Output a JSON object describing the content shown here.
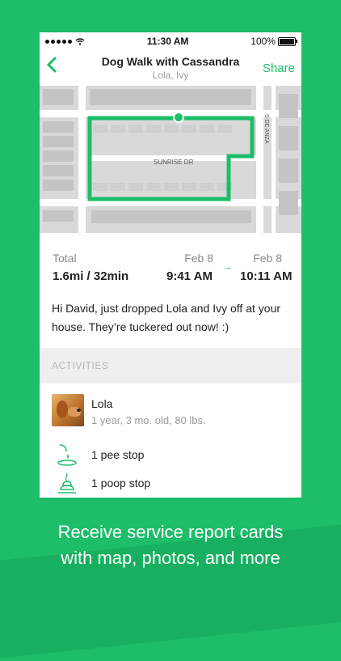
{
  "status_bar": {
    "time": "11:30 AM",
    "battery": "100%"
  },
  "navbar": {
    "back_icon": "chevron-left-icon",
    "title": "Dog Walk with Cassandra",
    "subtitle": "Lola, Ivy",
    "share_label": "Share"
  },
  "map": {
    "street_label": "SUNRISE DR",
    "side_street_label": "S DE ANZA",
    "route_color": "#1dbd6a"
  },
  "summary": {
    "total_label": "Total",
    "total_value": "1.6mi / 32min",
    "start_date": "Feb 8",
    "start_time": "9:41 AM",
    "end_date": "Feb 8",
    "end_time": "10:11 AM",
    "arrow_icon": "arrow-right-icon"
  },
  "message": "Hi David, just dropped Lola and Ivy off at your house. They’re tuckered out now! :)",
  "activities": {
    "header": "ACTIVITIES",
    "dog": {
      "name": "Lola",
      "details": "1 year, 3 mo. old, 80 lbs."
    },
    "stops": [
      {
        "icon": "pee-stop-icon",
        "label": "1 pee stop"
      },
      {
        "icon": "poop-stop-icon",
        "label": "1 poop stop"
      }
    ]
  },
  "caption": {
    "line1": "Receive service report cards",
    "line2": "with map, photos, and more"
  },
  "colors": {
    "accent": "#1dbd6a",
    "background": "#1dbd6a"
  }
}
